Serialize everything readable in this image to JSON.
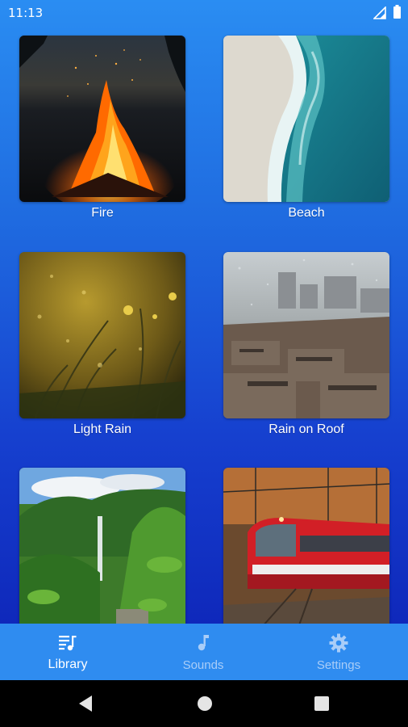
{
  "status_bar": {
    "time": "11:13",
    "icons": [
      "signal-icon",
      "battery-icon"
    ]
  },
  "library": {
    "tiles": [
      {
        "label": "Fire",
        "image": "campfire-at-night"
      },
      {
        "label": "Beach",
        "image": "aerial-beach-waves"
      },
      {
        "label": "Light Rain",
        "image": "raindrops-on-grass"
      },
      {
        "label": "Rain on Roof",
        "image": "rainy-window-city"
      },
      {
        "label": "",
        "image": "jungle-waterfall"
      },
      {
        "label": "",
        "image": "red-train-forest"
      }
    ]
  },
  "bottom_nav": {
    "items": [
      {
        "label": "Library",
        "icon": "library-music-icon",
        "active": true
      },
      {
        "label": "Sounds",
        "icon": "music-note-icon",
        "active": false
      },
      {
        "label": "Settings",
        "icon": "gear-icon",
        "active": false
      }
    ]
  },
  "colors": {
    "bottom_nav_bg": "#2f8cf0",
    "active_label": "#ffffff",
    "inactive_label": "#a9cdf8"
  }
}
